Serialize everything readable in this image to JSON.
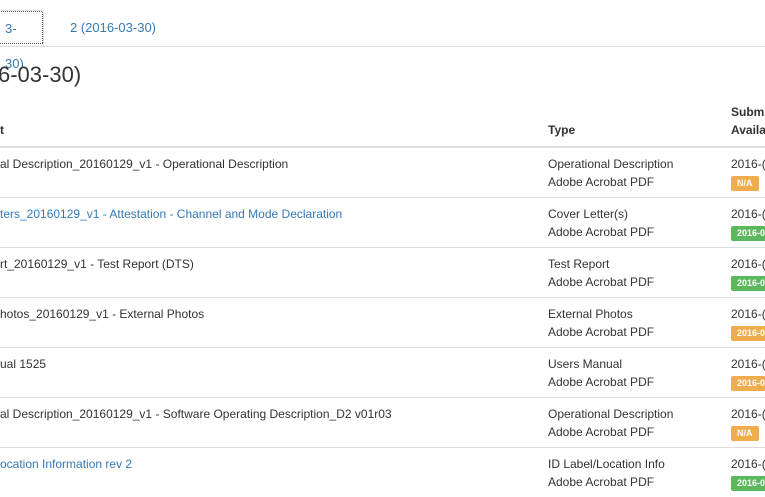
{
  "tabs": [
    {
      "label": "3-30)"
    },
    {
      "label": "2 (2016-03-30)"
    }
  ],
  "page_title": "6-03-30)",
  "table": {
    "headers": {
      "document": "t",
      "type": "Type",
      "submitted_line1": "Subm",
      "submitted_line2": "Availa"
    },
    "rows": [
      {
        "document": "al Description_20160129_v1 - Operational Description",
        "link": false,
        "type": "Operational Description",
        "format": "Adobe Acrobat PDF",
        "date": "2016-(",
        "badge": "N/A",
        "badge_color": "#f0ad4e"
      },
      {
        "document": "ters_20160129_v1 - Attestation - Channel and Mode Declaration",
        "link": true,
        "type": "Cover Letter(s)",
        "format": "Adobe Acrobat PDF",
        "date": "2016-(",
        "badge": "2016-0",
        "badge_color": "#5cb85c"
      },
      {
        "document": "rt_20160129_v1 - Test Report (DTS)",
        "link": false,
        "type": "Test Report",
        "format": "Adobe Acrobat PDF",
        "date": "2016-(",
        "badge": "2016-0",
        "badge_color": "#5cb85c"
      },
      {
        "document": "hotos_20160129_v1 - External Photos",
        "link": false,
        "type": "External Photos",
        "format": "Adobe Acrobat PDF",
        "date": "2016-(",
        "badge": "2016-0",
        "badge_color": "#f0ad4e"
      },
      {
        "document": "ual 1525",
        "link": false,
        "type": "Users Manual",
        "format": "Adobe Acrobat PDF",
        "date": "2016-(",
        "badge": "2016-0",
        "badge_color": "#f0ad4e"
      },
      {
        "document": "al Description_20160129_v1 - Software Operating Description_D2 v01r03",
        "link": false,
        "type": "Operational Description",
        "format": "Adobe Acrobat PDF",
        "date": "2016-(",
        "badge": "N/A",
        "badge_color": "#f0ad4e"
      },
      {
        "document": "ocation Information rev 2",
        "link": true,
        "type": "ID Label/Location Info",
        "format": "Adobe Acrobat PDF",
        "date": "2016-(",
        "badge": "2016-0",
        "badge_color": "#5cb85c"
      }
    ]
  }
}
